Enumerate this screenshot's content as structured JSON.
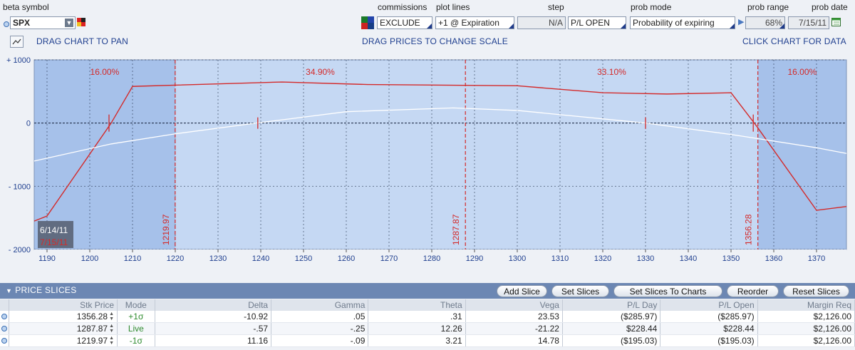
{
  "toolbar": {
    "beta_symbol_label": "beta symbol",
    "symbol_value": "SPX",
    "commissions_label": "commissions",
    "commissions_value": "EXCLUDE",
    "plot_lines_label": "plot lines",
    "plot_lines_value": "+1 @ Expiration",
    "step_label": "step",
    "step_value": "N/A",
    "pl_mode_value": "P/L OPEN",
    "prob_mode_label": "prob mode",
    "prob_mode_value": "Probability of expiring",
    "prob_range_label": "prob range",
    "prob_range_value": "68%",
    "prob_date_label": "prob date",
    "prob_date_value": "7/15/11"
  },
  "hints": {
    "pan": "DRAG CHART TO PAN",
    "scale": "DRAG PRICES TO CHANGE SCALE",
    "data": "CLICK CHART FOR DATA"
  },
  "colors": {
    "plot_bg": "#c5d8f3",
    "plot_bg_outer": "#a6c1ea",
    "pl_expiration_line": "#d42a2a",
    "pl_today_line": "#ffffff",
    "accent_bar": "#6c87b3"
  },
  "chart_data": {
    "type": "line",
    "xlim": [
      1187,
      1377
    ],
    "ylim": [
      -2000,
      1000
    ],
    "x_ticks": [
      1190,
      1200,
      1210,
      1220,
      1230,
      1240,
      1250,
      1260,
      1270,
      1280,
      1290,
      1300,
      1310,
      1320,
      1330,
      1340,
      1350,
      1360,
      1370
    ],
    "y_ticks": [
      1000,
      0,
      -1000,
      -2000
    ],
    "y_tick_labels": [
      "+ 1000",
      "0",
      "- 1000",
      "- 2000"
    ],
    "series": [
      {
        "name": "+1 @ Expiration",
        "x": [
          1187,
          1190,
          1205,
          1210,
          1220,
          1245,
          1265,
          1300,
          1320,
          1335,
          1350,
          1356,
          1370,
          1377
        ],
        "y": [
          -1550,
          -1470,
          0,
          580,
          600,
          650,
          610,
          590,
          480,
          460,
          480,
          -50,
          -1380,
          -1320
        ]
      },
      {
        "name": "Today",
        "x": [
          1187,
          1205,
          1220,
          1239,
          1260,
          1285,
          1300,
          1330,
          1350,
          1370,
          1377
        ],
        "y": [
          -600,
          -330,
          -170,
          0,
          180,
          240,
          200,
          0,
          -180,
          -390,
          -480
        ]
      }
    ],
    "probability_regions": [
      {
        "from": 1187,
        "to": 1219.97,
        "label": "16.00%"
      },
      {
        "from": 1219.97,
        "to": 1287.87,
        "label": "34.90%"
      },
      {
        "from": 1287.87,
        "to": 1356.28,
        "label": "33.10%"
      },
      {
        "from": 1356.28,
        "to": 1377,
        "label": "16.00%"
      }
    ],
    "price_markers": [
      {
        "x": 1219.97,
        "label": "1219.97"
      },
      {
        "x": 1287.87,
        "label": "1287.87"
      },
      {
        "x": 1356.28,
        "label": "1356.28"
      }
    ],
    "breakeven_ticks_expiration": [
      1204.5,
      1355.2
    ],
    "breakeven_ticks_today": [
      1239.3,
      1330
    ],
    "date_labels": [
      "6/14/11",
      "7/15/11"
    ]
  },
  "price_slices": {
    "title": "PRICE SLICES",
    "buttons": [
      "Add Slice",
      "Set Slices",
      "Set Slices To Charts",
      "Reorder",
      "Reset Slices"
    ],
    "columns": [
      "Stk Price",
      "Mode",
      "Delta",
      "Gamma",
      "Theta",
      "Vega",
      "P/L Day",
      "P/L Open",
      "Margin Req"
    ],
    "rows": [
      {
        "price": "1356.28",
        "mode": "+1σ",
        "delta": "-10.92",
        "gamma": ".05",
        "theta": ".31",
        "vega": "23.53",
        "pl_day": "($285.97)",
        "pl_open": "($285.97)",
        "margin": "$2,126.00"
      },
      {
        "price": "1287.87",
        "mode": "Live",
        "delta": "-.57",
        "gamma": "-.25",
        "theta": "12.26",
        "vega": "-21.22",
        "pl_day": "$228.44",
        "pl_open": "$228.44",
        "margin": "$2,126.00"
      },
      {
        "price": "1219.97",
        "mode": "-1σ",
        "delta": "11.16",
        "gamma": "-.09",
        "theta": "3.21",
        "vega": "14.78",
        "pl_day": "($195.03)",
        "pl_open": "($195.03)",
        "margin": "$2,126.00"
      }
    ]
  }
}
